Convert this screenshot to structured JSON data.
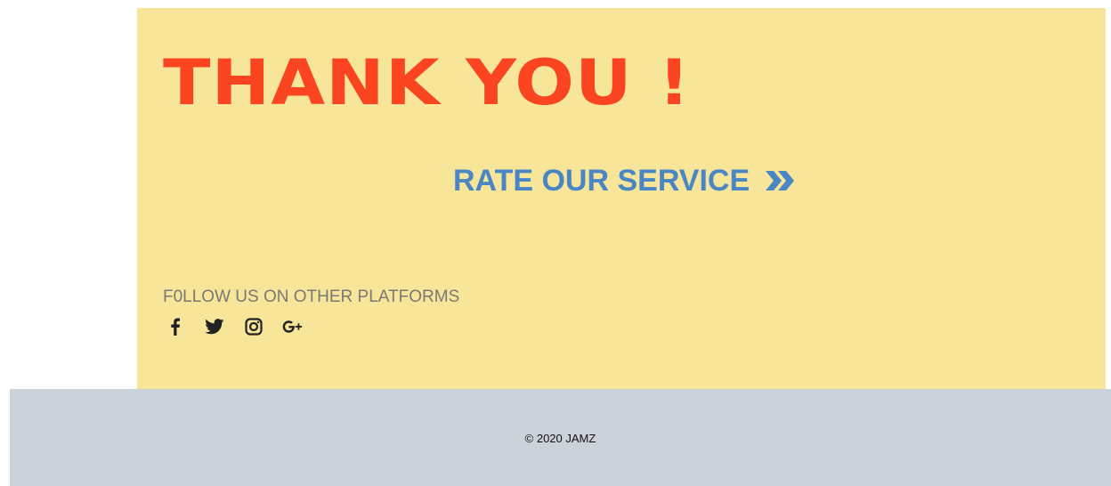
{
  "thanks": {
    "title": "THANK YOU !"
  },
  "rate": {
    "label": "RATE OUR SERVICE",
    "icon": "double-chevron-right-icon"
  },
  "follow": {
    "label": "F0LLOW US ON OTHER PLATFORMS",
    "platforms": [
      {
        "name": "facebook",
        "icon": "facebook-icon"
      },
      {
        "name": "twitter",
        "icon": "twitter-icon"
      },
      {
        "name": "instagram",
        "icon": "instagram-icon"
      },
      {
        "name": "google-plus",
        "icon": "google-plus-icon"
      }
    ]
  },
  "footer": {
    "copyright": "© 2020 JAMZ"
  },
  "colors": {
    "panel_bg": "#f7e599",
    "title": "#fb4520",
    "link": "#4a86c4",
    "muted_text": "#7a7877",
    "footer_bg": "#ccd2da"
  }
}
